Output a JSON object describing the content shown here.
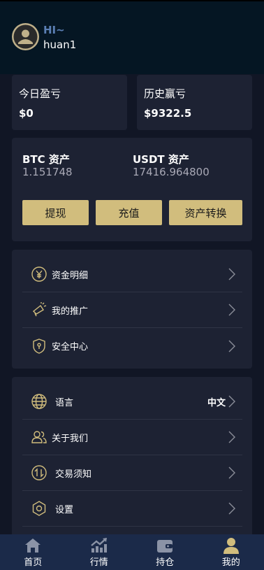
{
  "header": {
    "greeting": "HI~",
    "username": "huan1"
  },
  "pnl": {
    "today_label": "今日盈亏",
    "today_value": "$0",
    "history_label": "历史赢亏",
    "history_value": "$9322.5"
  },
  "assets": {
    "btc_label": "BTC 资产",
    "btc_value": "1.151748",
    "usdt_label": "USDT 资产",
    "usdt_value": "17416.964800",
    "buttons": [
      "提现",
      "充值",
      "资产转换"
    ]
  },
  "menu1": [
    {
      "label": "资金明细",
      "icon": "yen-circle-icon"
    },
    {
      "label": "我的推广",
      "icon": "megaphone-icon"
    },
    {
      "label": "安全中心",
      "icon": "shield-icon"
    }
  ],
  "menu2": [
    {
      "label": "语言",
      "icon": "globe-icon",
      "extra": "中文"
    },
    {
      "label": "关于我们",
      "icon": "users-icon"
    },
    {
      "label": "交易须知",
      "icon": "exchange-icon"
    },
    {
      "label": "设置",
      "icon": "gear-icon"
    }
  ],
  "tabbar": [
    {
      "label": "首页",
      "icon": "home-icon"
    },
    {
      "label": "行情",
      "icon": "market-chart-icon"
    },
    {
      "label": "持仓",
      "icon": "wallet-icon"
    },
    {
      "label": "我的",
      "icon": "user-icon",
      "active": true
    }
  ],
  "colors": {
    "gold": "#d1bd7d",
    "card": "#1d2233",
    "header": "#051623",
    "tabbar": "#1b2a49",
    "greeting": "#5b7fb4"
  }
}
